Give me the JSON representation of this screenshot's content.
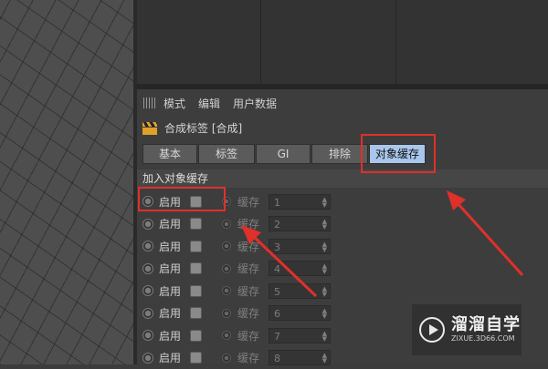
{
  "menu": {
    "items": [
      "模式",
      "编辑",
      "用户数据"
    ]
  },
  "tag": {
    "title": "合成标签 [合成]"
  },
  "tabs": [
    {
      "label": "基本",
      "active": false
    },
    {
      "label": "标签",
      "active": false
    },
    {
      "label": "GI",
      "active": false
    },
    {
      "label": "排除",
      "active": false
    },
    {
      "label": "对象缓存",
      "active": true
    }
  ],
  "section": {
    "title": "加入对象缓存"
  },
  "cache_rows": [
    {
      "enable_label": "启用",
      "cache_label": "缓存",
      "value": "1"
    },
    {
      "enable_label": "启用",
      "cache_label": "缓存",
      "value": "2"
    },
    {
      "enable_label": "启用",
      "cache_label": "缓存",
      "value": "3"
    },
    {
      "enable_label": "启用",
      "cache_label": "缓存",
      "value": "4"
    },
    {
      "enable_label": "启用",
      "cache_label": "缓存",
      "value": "5"
    },
    {
      "enable_label": "启用",
      "cache_label": "缓存",
      "value": "6"
    },
    {
      "enable_label": "启用",
      "cache_label": "缓存",
      "value": "7"
    },
    {
      "enable_label": "启用",
      "cache_label": "缓存",
      "value": "8"
    }
  ],
  "watermark": {
    "name": "溜溜自学",
    "url": "ZIXUE.3D66.COM"
  },
  "colors": {
    "highlight": "#e0302a",
    "active_tab": "#a9c7ec",
    "panel_bg": "#3d3d3d"
  }
}
